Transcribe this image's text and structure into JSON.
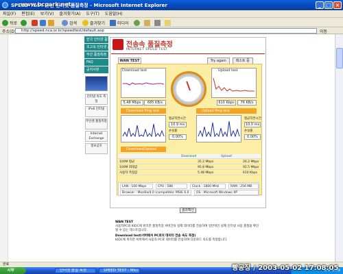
{
  "window": {
    "title": "SPEED TEST 유선 인터넷 품질측정 - Microsoft Internet Explorer",
    "watermark_url": "www.bcpark.net"
  },
  "menu": [
    "파일(F)",
    "편집(E)",
    "보기(V)",
    "즐겨찾기(A)",
    "도구(T)",
    "도움말(H)"
  ],
  "toolbar": {
    "back": "뒤로",
    "search": "검색",
    "favorites": "즐겨찾기",
    "media": "미디어"
  },
  "address": {
    "label": "주소(D)",
    "url": "http://speed.nca.or.kr/speedtest/default.asp",
    "go": "이동"
  },
  "sidebar": {
    "nav": [
      "한국 인터넷 품질측정",
      "초고속 인터넷 품질측정",
      "무선 품질측정",
      "FAQ",
      "공지사항"
    ],
    "banners": [
      "인터넷 속도 측정",
      "IPv6 인터넷",
      "무선랜 품질측정",
      "Internet Exchange",
      "정보공유"
    ]
  },
  "page": {
    "title": "전송속 품질측정",
    "subtitle": "INTERNET SPEED TEST",
    "tab": "WAN TEST",
    "btn_retry": "Try again",
    "btn_test": "테스트 중"
  },
  "download": {
    "label": "Download test",
    "value1": "5.48 Mbps",
    "value2": "685 KB/s"
  },
  "upload": {
    "label": "Upload test",
    "value1": "610 Kbps",
    "value2": "76 KB/s"
  },
  "sections": {
    "left": "Download Ping test",
    "right": "Upload Ping test",
    "avg": "Download/Upload"
  },
  "ping_left": {
    "avg_label": "평균지연시간",
    "avg": "10.9 ms",
    "loss_label": "손실률",
    "loss": "0.00%"
  },
  "ping_right": {
    "avg_label": "평균지연시간",
    "avg": "10.0 ms",
    "loss_label": "손실률",
    "loss": "0.00%"
  },
  "summary": {
    "headers": [
      "",
      "Download",
      "Upload"
    ],
    "rows": [
      {
        "label": "100M 평균",
        "dl": "35.2 Mbps",
        "ul": "26.2 Mbps"
      },
      {
        "label": "100M 최대값",
        "dl": "95.8 Mbps",
        "ul": "92.5 Mbps"
      },
      {
        "label": "사용자 측정값",
        "dl": "5.48 Mbps",
        "ul": "610 Kbps"
      }
    ]
  },
  "sysinfo": {
    "lan": "LAN : 100 Mbps",
    "cpu": "CPU : 586",
    "clock": "Clock : 1800 MHz",
    "ram": "RAM : 256 MB",
    "browser": "Browser : Mozilla/4.0 (compatible; MSIE 6.0",
    "os": "OS : Microsoft Windows XP"
  },
  "result_button": "결과확인",
  "description": {
    "h1": "WAN TEST",
    "p1": "사용자PC와 KIDC에 위치한 품질측정 서버간의 실제 데이터를 전송하여 일반적인 실제 인터넷 사용 품질을 확인할 수 있는 테스트입니다.",
    "h2": "Download test(서버에서 PC로의 데이터 전송 속도 측정)",
    "p2": "KIDC에 위치한 서버에서 사용자 PC로 데이터를 전송하여 다운로드 속도를 측정합니다."
  },
  "status": "완료",
  "taskbar": {
    "start": "시작",
    "tasks": [
      "인터넷 품질 측정",
      "SPEED TEST - Micr..."
    ],
    "clock": "오후 5:08"
  },
  "watermark": "빵공장 / 2003-05-02 17:08:05"
}
